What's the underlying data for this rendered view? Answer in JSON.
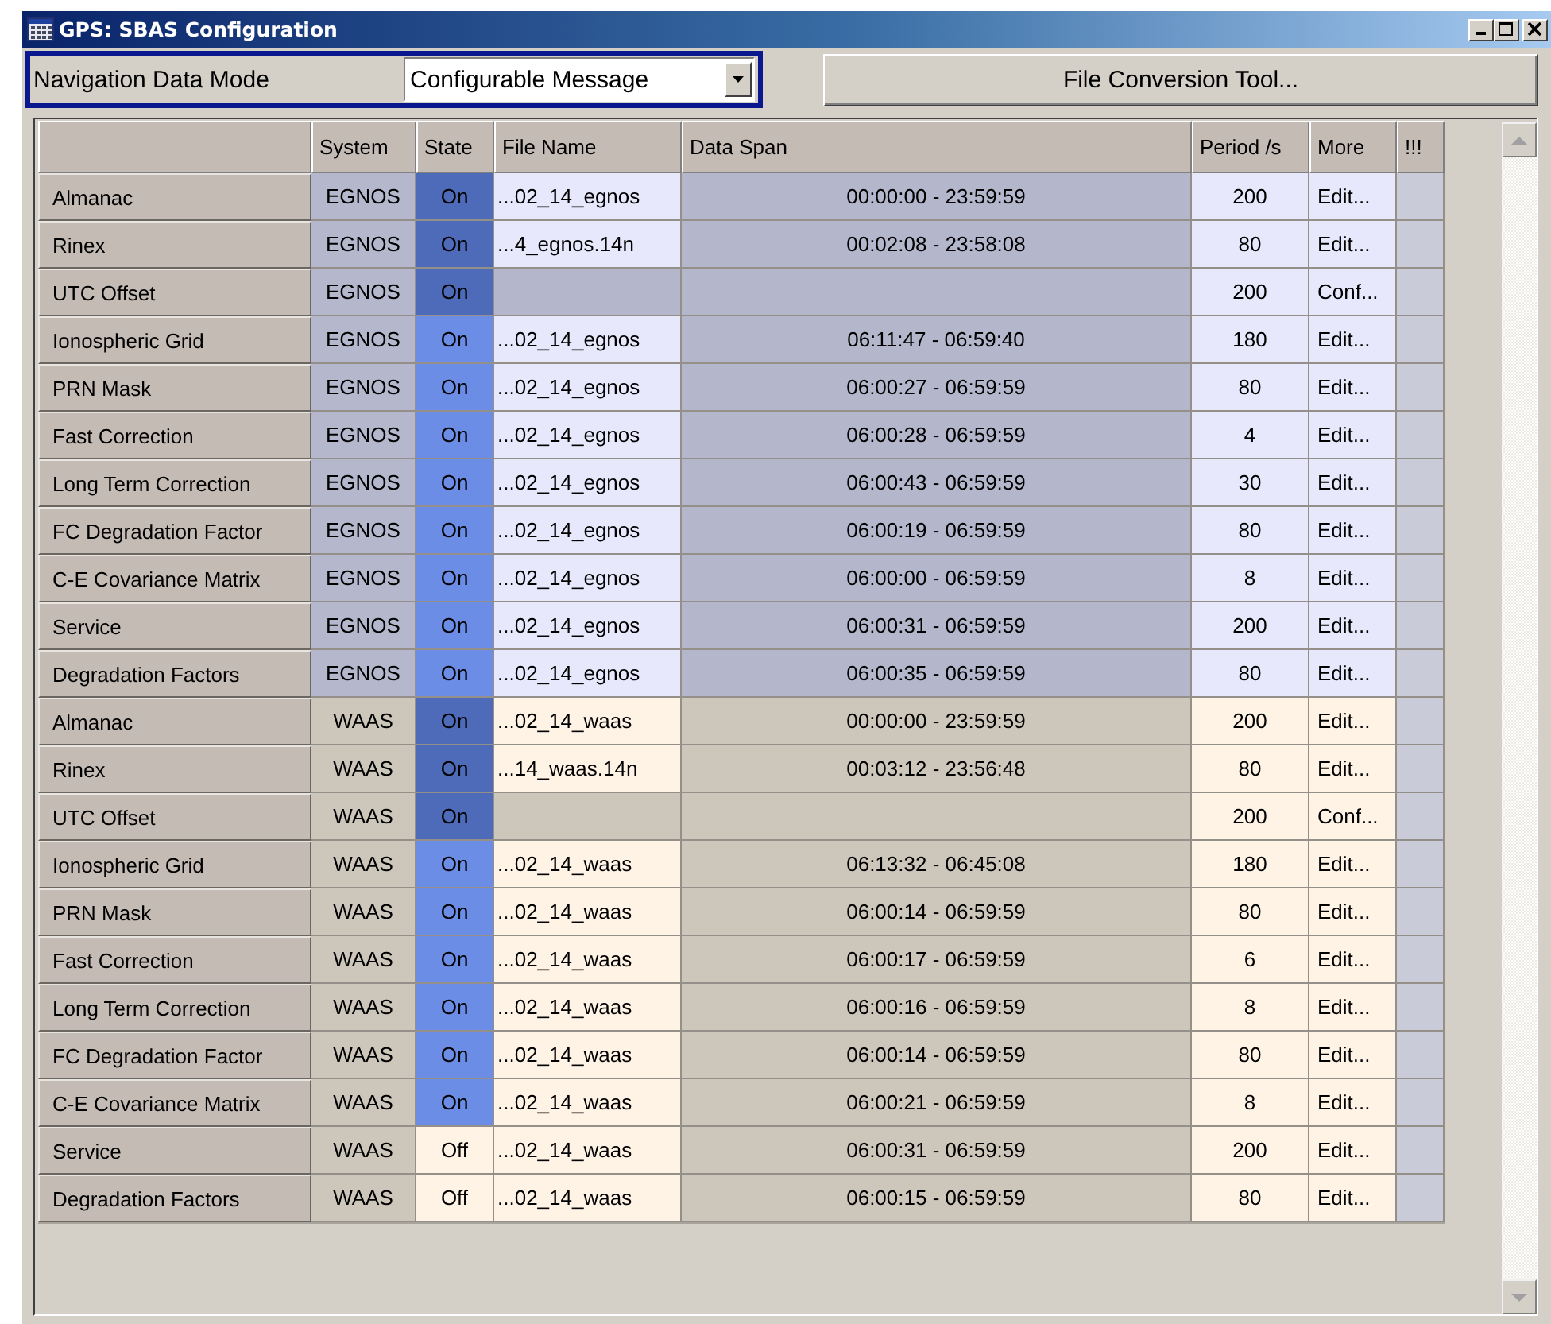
{
  "window": {
    "title": "GPS: SBAS Configuration"
  },
  "navigation_mode": {
    "label": "Navigation Data Mode",
    "value": "Configurable Message",
    "focused": true
  },
  "file_conversion_button": "File Conversion Tool...",
  "table": {
    "columns": [
      "System",
      "State",
      "File Name",
      "Data Span",
      "Period /s",
      "More",
      "!!!"
    ],
    "groups": [
      {
        "rows": [
          {
            "message": "Almanac",
            "system": "EGNOS",
            "state": "On",
            "on": true,
            "highlighted": true,
            "file": "...02_14_egnos",
            "span": "00:00:00 - 23:59:59",
            "period": "200",
            "more": "Edit..."
          },
          {
            "message": "Rinex",
            "system": "EGNOS",
            "state": "On",
            "on": true,
            "highlighted": true,
            "file": "...4_egnos.14n",
            "span": "00:02:08 - 23:58:08",
            "period": "80",
            "more": "Edit..."
          },
          {
            "message": "UTC Offset",
            "system": "EGNOS",
            "state": "On",
            "on": true,
            "highlighted": true,
            "period": "200",
            "more": "Conf..."
          },
          {
            "message": "Ionospheric Grid",
            "system": "EGNOS",
            "state": "On",
            "on": true,
            "highlighted": false,
            "file": "...02_14_egnos",
            "span": "06:11:47 - 06:59:40",
            "period": "180",
            "more": "Edit..."
          },
          {
            "message": "PRN Mask",
            "system": "EGNOS",
            "state": "On",
            "on": true,
            "highlighted": false,
            "file": "...02_14_egnos",
            "span": "06:00:27 - 06:59:59",
            "period": "80",
            "more": "Edit..."
          },
          {
            "message": "Fast Correction",
            "system": "EGNOS",
            "state": "On",
            "on": true,
            "highlighted": false,
            "file": "...02_14_egnos",
            "span": "06:00:28 - 06:59:59",
            "period": "4",
            "more": "Edit..."
          },
          {
            "message": "Long Term Correction",
            "system": "EGNOS",
            "state": "On",
            "on": true,
            "highlighted": false,
            "file": "...02_14_egnos",
            "span": "06:00:43 - 06:59:59",
            "period": "30",
            "more": "Edit..."
          },
          {
            "message": "FC Degradation Factor",
            "system": "EGNOS",
            "state": "On",
            "on": true,
            "highlighted": false,
            "file": "...02_14_egnos",
            "span": "06:00:19 - 06:59:59",
            "period": "80",
            "more": "Edit..."
          },
          {
            "message": "C-E Covariance Matrix",
            "system": "EGNOS",
            "state": "On",
            "on": true,
            "highlighted": false,
            "file": "...02_14_egnos",
            "span": "06:00:00 - 06:59:59",
            "period": "8",
            "more": "Edit..."
          },
          {
            "message": "Service",
            "system": "EGNOS",
            "state": "On",
            "on": true,
            "highlighted": false,
            "file": "...02_14_egnos",
            "span": "06:00:31 - 06:59:59",
            "period": "200",
            "more": "Edit..."
          },
          {
            "message": "Degradation Factors",
            "system": "EGNOS",
            "state": "On",
            "on": true,
            "highlighted": false,
            "file": "...02_14_egnos",
            "span": "06:00:35 - 06:59:59",
            "period": "80",
            "more": "Edit..."
          }
        ]
      },
      {
        "rows": [
          {
            "message": "Almanac",
            "system": "WAAS",
            "state": "On",
            "on": true,
            "highlighted": true,
            "file": "...02_14_waas",
            "span": "00:00:00 - 23:59:59",
            "period": "200",
            "more": "Edit..."
          },
          {
            "message": "Rinex",
            "system": "WAAS",
            "state": "On",
            "on": true,
            "highlighted": true,
            "file": "...14_waas.14n",
            "span": "00:03:12 - 23:56:48",
            "period": "80",
            "more": "Edit..."
          },
          {
            "message": "UTC Offset",
            "system": "WAAS",
            "state": "On",
            "on": true,
            "highlighted": true,
            "period": "200",
            "more": "Conf..."
          },
          {
            "message": "Ionospheric Grid",
            "system": "WAAS",
            "state": "On",
            "on": true,
            "highlighted": false,
            "file": "...02_14_waas",
            "span": "06:13:32 - 06:45:08",
            "period": "180",
            "more": "Edit..."
          },
          {
            "message": "PRN Mask",
            "system": "WAAS",
            "state": "On",
            "on": true,
            "highlighted": false,
            "file": "...02_14_waas",
            "span": "06:00:14 - 06:59:59",
            "period": "80",
            "more": "Edit..."
          },
          {
            "message": "Fast Correction",
            "system": "WAAS",
            "state": "On",
            "on": true,
            "highlighted": false,
            "file": "...02_14_waas",
            "span": "06:00:17 - 06:59:59",
            "period": "6",
            "more": "Edit..."
          },
          {
            "message": "Long Term Correction",
            "system": "WAAS",
            "state": "On",
            "on": true,
            "highlighted": false,
            "file": "...02_14_waas",
            "span": "06:00:16 - 06:59:59",
            "period": "8",
            "more": "Edit..."
          },
          {
            "message": "FC Degradation Factor",
            "system": "WAAS",
            "state": "On",
            "on": true,
            "highlighted": false,
            "file": "...02_14_waas",
            "span": "06:00:14 - 06:59:59",
            "period": "80",
            "more": "Edit..."
          },
          {
            "message": "C-E Covariance Matrix",
            "system": "WAAS",
            "state": "On",
            "on": true,
            "highlighted": false,
            "file": "...02_14_waas",
            "span": "06:00:21 - 06:59:59",
            "period": "8",
            "more": "Edit..."
          },
          {
            "message": "Service",
            "system": "WAAS",
            "state": "Off",
            "on": false,
            "highlighted": false,
            "file": "...02_14_waas",
            "span": "06:00:31 - 06:59:59",
            "period": "200",
            "more": "Edit..."
          },
          {
            "message": "Degradation Factors",
            "system": "WAAS",
            "state": "Off",
            "on": false,
            "highlighted": false,
            "file": "...02_14_waas",
            "span": "06:00:15 - 06:59:59",
            "period": "80",
            "more": "Edit..."
          }
        ]
      }
    ]
  }
}
